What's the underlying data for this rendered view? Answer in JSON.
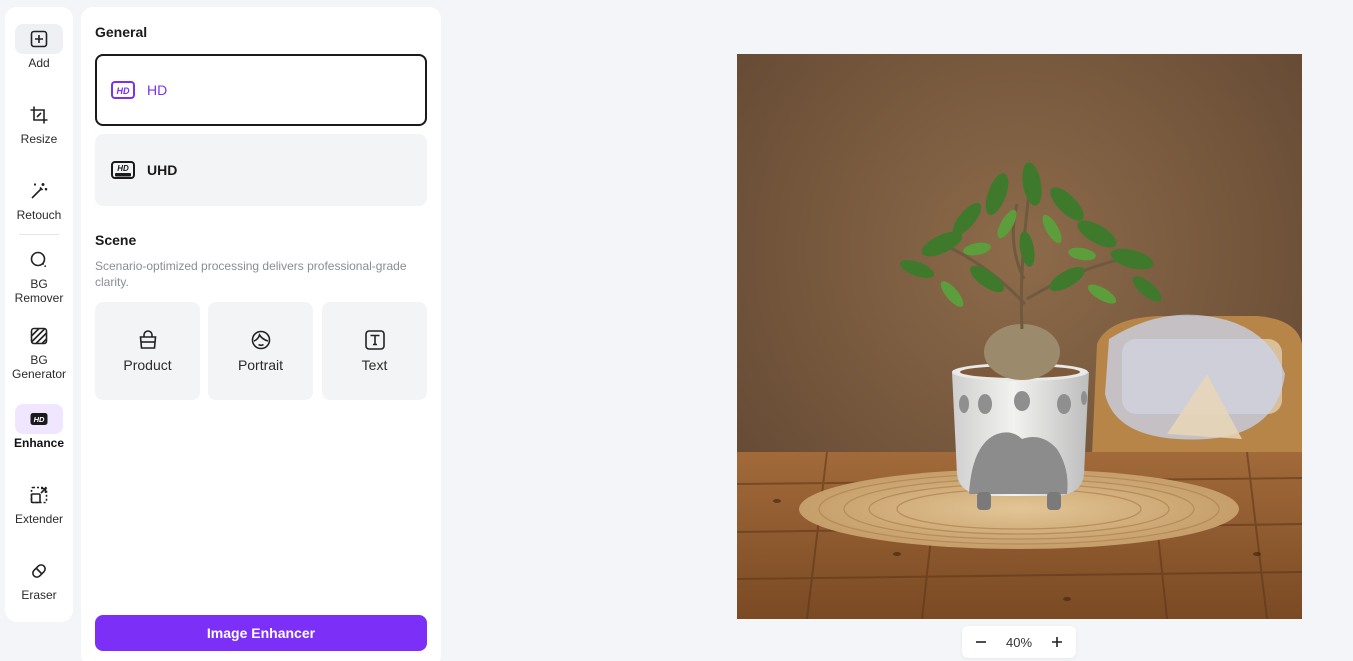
{
  "sidebar": {
    "tools": [
      {
        "label": "Add",
        "icon": "add-square-icon"
      },
      {
        "label": "Resize",
        "icon": "crop-icon"
      },
      {
        "label": "Retouch",
        "icon": "magic-wand-icon"
      },
      {
        "label": "BG\nRemover",
        "icon": "bg-remover-icon"
      },
      {
        "label": "BG\nGenerator",
        "icon": "bg-generator-icon"
      },
      {
        "label": "Enhance",
        "icon": "hd-icon",
        "active": true
      },
      {
        "label": "Extender",
        "icon": "extend-icon"
      },
      {
        "label": "Eraser",
        "icon": "eraser-icon"
      }
    ]
  },
  "panel": {
    "general_title": "General",
    "quality_options": [
      {
        "label": "HD",
        "icon": "hd-icon",
        "selected": true
      },
      {
        "label": "UHD",
        "icon": "hd-ultra-icon",
        "selected": false
      }
    ],
    "scene_title": "Scene",
    "scene_description": "Scenario-optimized processing delivers professional-grade clarity.",
    "scenes": [
      {
        "label": "Product",
        "icon": "bag-icon"
      },
      {
        "label": "Portrait",
        "icon": "face-icon"
      },
      {
        "label": "Text",
        "icon": "text-icon"
      }
    ],
    "enhance_button": "Image Enhancer"
  },
  "zoom": {
    "value": "40%"
  },
  "colors": {
    "accent": "#7b2ff7",
    "accent_light": "#f0e6ff",
    "background": "#f4f5f9"
  }
}
